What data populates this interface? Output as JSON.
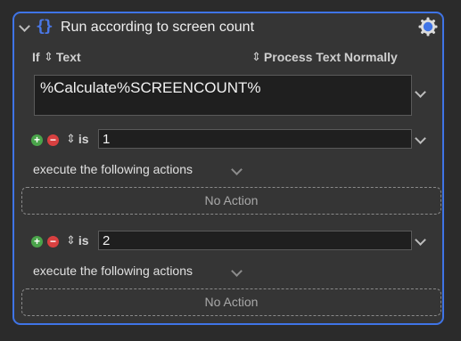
{
  "action": {
    "title": "Run according to screen count",
    "icon": "curly-braces-icon",
    "settings_icon": "gear-icon",
    "accent_color": "#3f74e6"
  },
  "condition": {
    "if_label": "If",
    "source_type": "Text",
    "process_mode": "Process Text Normally",
    "expression": "%Calculate%SCREENCOUNT%"
  },
  "cases": [
    {
      "operator": "is",
      "value": "1",
      "execute_label": "execute the following actions",
      "empty_label": "No Action"
    },
    {
      "operator": "is",
      "value": "2",
      "execute_label": "execute the following actions",
      "empty_label": "No Action"
    }
  ]
}
